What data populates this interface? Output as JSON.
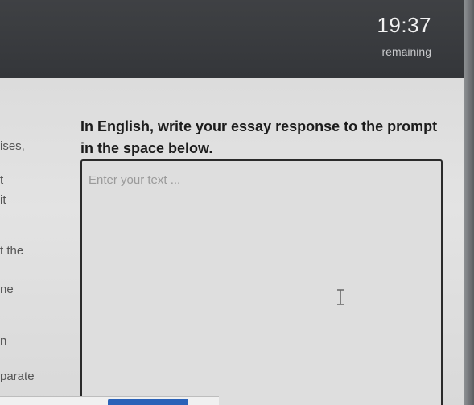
{
  "timer": {
    "value": "19:37",
    "label": "remaining"
  },
  "left_fragments": [
    "ises,",
    "t",
    "it",
    "t the",
    "ne",
    "n",
    "parate"
  ],
  "prompt": {
    "text": "In English, write your essay response to the prompt in the space below."
  },
  "essay": {
    "placeholder": "Enter your text ...",
    "value": ""
  },
  "icons": {
    "cursor": "text-cursor-icon"
  },
  "colors": {
    "header": "#3a3c3f",
    "content": "#dedede",
    "button": "#2a62b8"
  }
}
